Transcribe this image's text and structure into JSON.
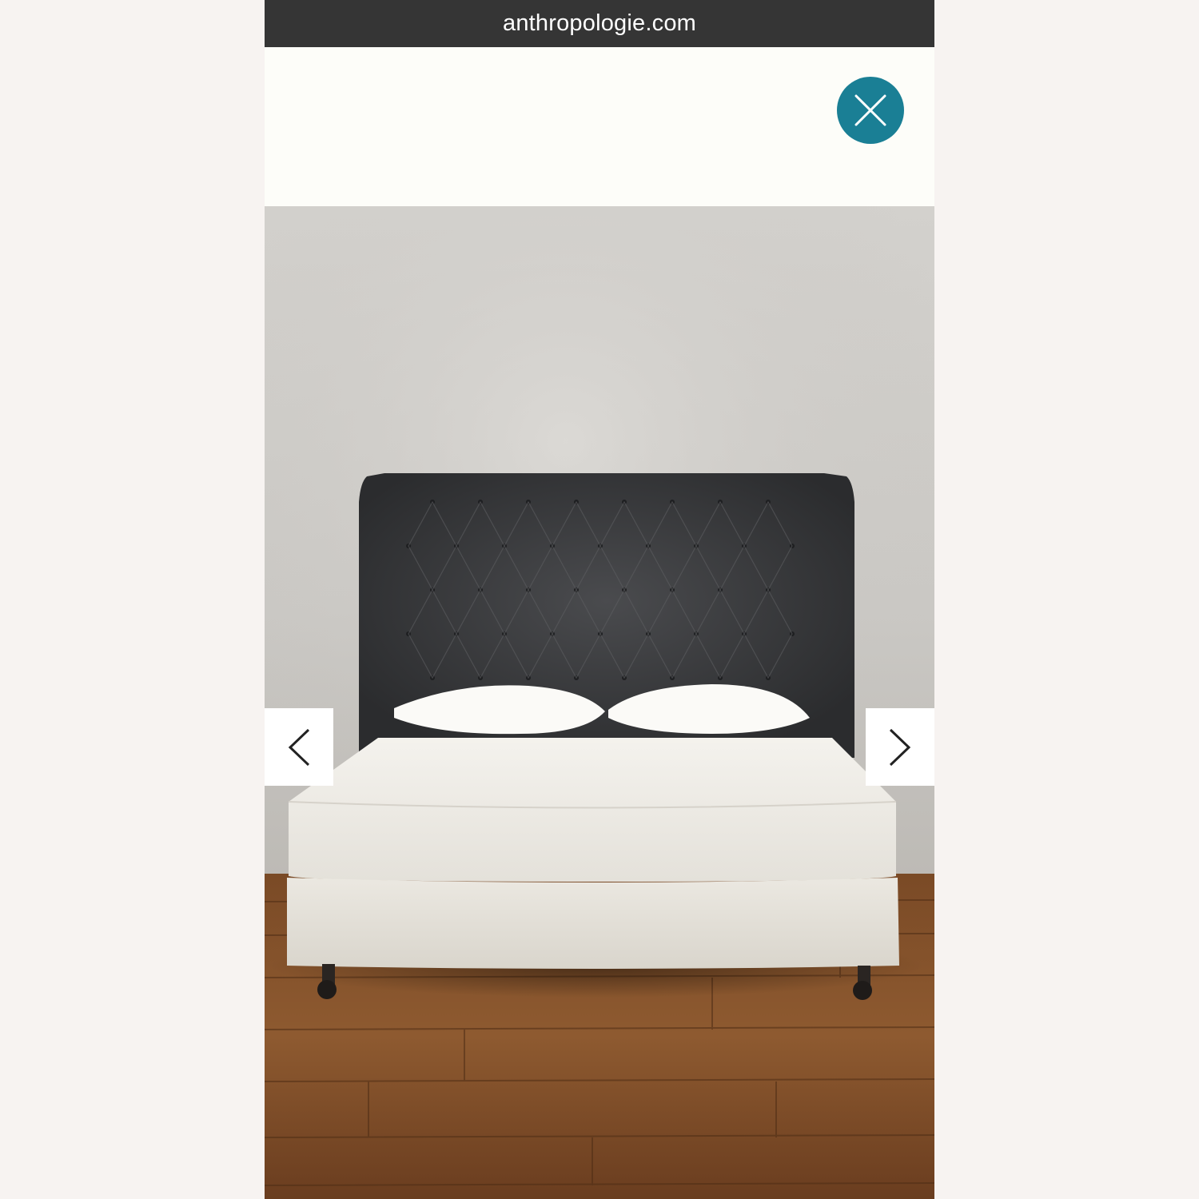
{
  "browser": {
    "url": "anthropologie.com"
  },
  "modal": {
    "close_icon": "close-icon",
    "accent_color": "#1a7f95"
  },
  "gallery": {
    "image_subject": "tufted dark velvet upholstered bed with white bedding",
    "prev_icon": "chevron-left-icon",
    "next_icon": "chevron-right-icon"
  }
}
